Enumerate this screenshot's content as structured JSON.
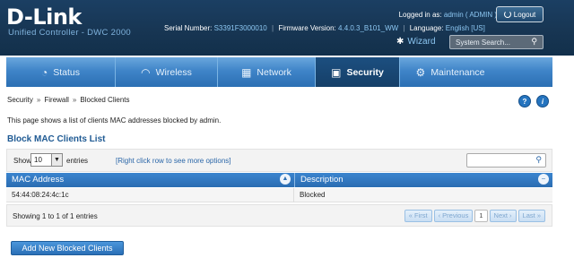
{
  "header": {
    "logo": "D-Link",
    "subtitle": "Unified Controller - DWC 2000",
    "logged_in_label": "Logged in as:",
    "logged_in_user": "admin ( ADMIN )",
    "logout_label": "Logout",
    "serial_label": "Serial Number:",
    "serial_value": "S3391F3000010",
    "firmware_label": "Firmware Version:",
    "firmware_value": "4.4.0.3_B101_WW",
    "language_label": "Language:",
    "language_value": "English [US]",
    "wizard_label": "Wizard",
    "search_placeholder": "System Search..."
  },
  "nav": {
    "items": [
      {
        "label": "Status",
        "icon": "gauge-icon"
      },
      {
        "label": "Wireless",
        "icon": "wifi-icon"
      },
      {
        "label": "Network",
        "icon": "network-icon"
      },
      {
        "label": "Security",
        "icon": "lock-icon",
        "active": true
      },
      {
        "label": "Maintenance",
        "icon": "gears-icon"
      }
    ]
  },
  "breadcrumb": [
    "Security",
    "Firewall",
    "Blocked Clients"
  ],
  "page_description": "This page shows a list of clients MAC addresses blocked by admin.",
  "list_title": "Block MAC Clients List",
  "toolbar": {
    "show_label": "Show",
    "show_value": "10",
    "entries_label": "entries",
    "right_click_hint": "[Right click row to see more options]"
  },
  "table": {
    "columns": [
      "MAC Address",
      "Description"
    ],
    "rows": [
      [
        "54:44:08:24:4c:1c",
        "Blocked"
      ]
    ]
  },
  "footer": {
    "showing_text": "Showing 1 to 1 of 1 entries",
    "pager": {
      "first": "First",
      "previous": "Previous",
      "page": "1",
      "next": "Next",
      "last": "Last"
    }
  },
  "add_button_label": "Add New Blocked Clients",
  "help_glyph": "?",
  "info_glyph": "i",
  "colors": {
    "header_bg": "#173552",
    "nav_bg": "#3f84c8",
    "nav_active": "#153f68",
    "table_header": "#2b6db2"
  }
}
